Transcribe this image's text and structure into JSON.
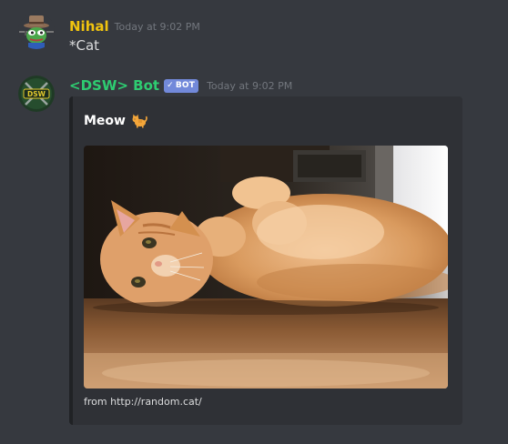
{
  "colors": {
    "background": "#36393f",
    "embed_background": "#2f3136",
    "nihal_username": "#f1c40f",
    "bot_username": "#2ecc71",
    "bot_tag": "#7289da",
    "timestamp": "#72767d",
    "text": "#dcddde"
  },
  "messages": [
    {
      "author": "Nihal",
      "timestamp": "Today at 9:02 PM",
      "content": "*Cat",
      "avatar_icon": "pepe-cowboy-avatar-icon"
    },
    {
      "author": "<DSW> Bot",
      "bot_tag": "BOT",
      "bot_tag_icon": "checkmark-icon",
      "timestamp": "Today at 9:02 PM",
      "avatar_icon": "dsw-logo-avatar-icon",
      "avatar_text": "DSW",
      "embed": {
        "title": "Meow",
        "title_emoji": "cat-emoji-icon",
        "image": "photo of orange cat lying on wooden floor",
        "footer": "from http://random.cat/"
      }
    }
  ]
}
